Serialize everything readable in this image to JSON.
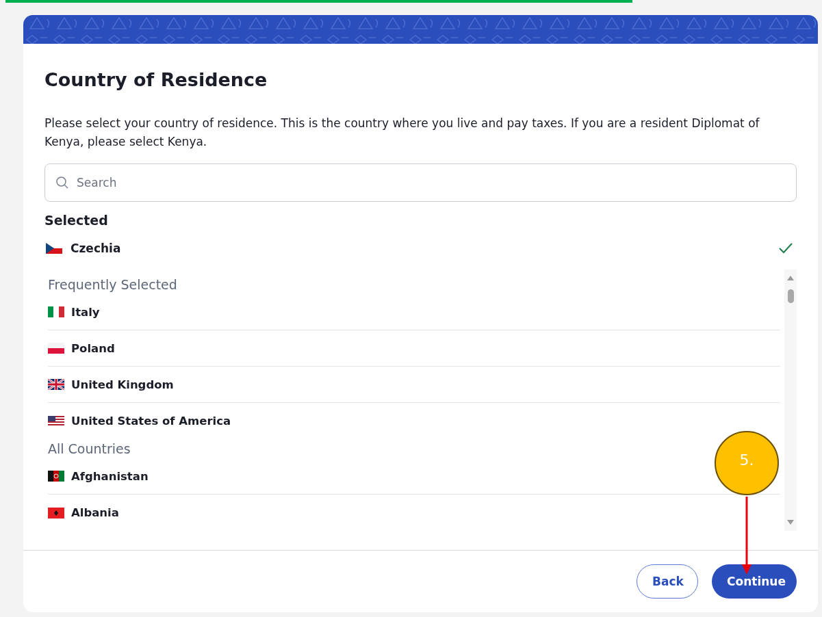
{
  "title": "Country of Residence",
  "description": "Please select your country of residence. This is the country where you live and pay taxes. If you are a resident Diplomat of Kenya, please select Kenya.",
  "search": {
    "placeholder": "Search"
  },
  "selected_section": {
    "heading": "Selected",
    "items": [
      {
        "label": "Czechia",
        "selected": true
      }
    ]
  },
  "groups": [
    {
      "heading": "Frequently Selected",
      "items": [
        {
          "label": "Italy"
        },
        {
          "label": "Poland"
        },
        {
          "label": "United Kingdom"
        },
        {
          "label": "United States of America"
        }
      ]
    },
    {
      "heading": "All Countries",
      "items": [
        {
          "label": "Afghanistan"
        },
        {
          "label": "Albania"
        }
      ]
    }
  ],
  "buttons": [
    {
      "label": "Back",
      "kind": "secondary"
    },
    {
      "label": "Continue",
      "kind": "primary"
    }
  ],
  "annotation": {
    "label": "5."
  }
}
